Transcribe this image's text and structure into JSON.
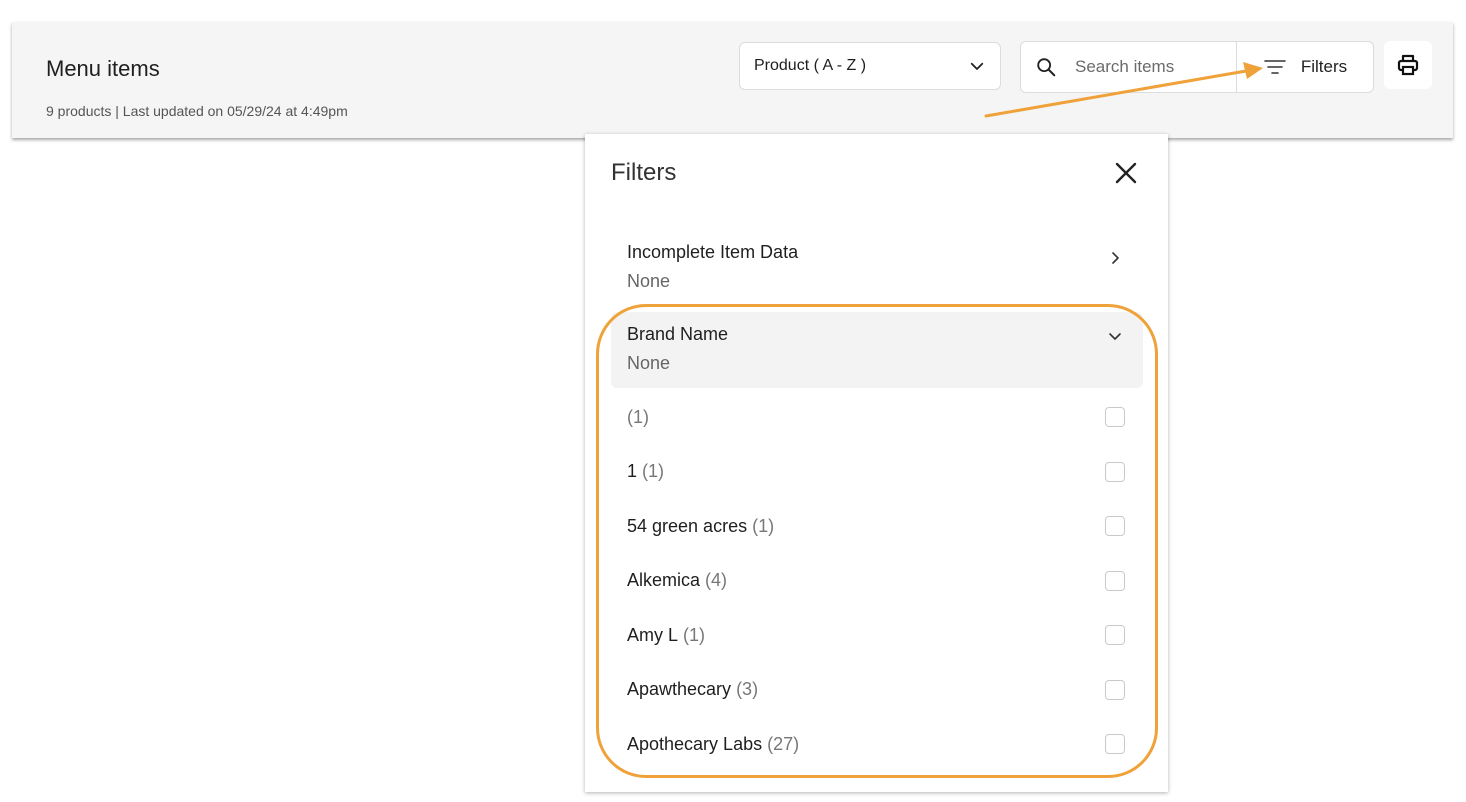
{
  "header": {
    "title": "Menu items",
    "subtitle": "9 products | Last updated on 05/29/24 at 4:49pm"
  },
  "sort": {
    "selected": "Product ( A - Z )"
  },
  "search": {
    "placeholder": "Search items",
    "value": ""
  },
  "filters_button": {
    "label": "Filters"
  },
  "filters_panel": {
    "title": "Filters",
    "sections": [
      {
        "name": "Incomplete Item Data",
        "value": "None",
        "state": "collapsed"
      },
      {
        "name": "Brand Name",
        "value": "None",
        "state": "expanded"
      }
    ],
    "brand_options": [
      {
        "label": "",
        "count": "(1)",
        "checked": false
      },
      {
        "label": "1",
        "count": "(1)",
        "checked": false
      },
      {
        "label": "54 green acres",
        "count": "(1)",
        "checked": false
      },
      {
        "label": "Alkemica",
        "count": "(4)",
        "checked": false
      },
      {
        "label": "Amy L",
        "count": "(1)",
        "checked": false
      },
      {
        "label": "Apawthecary",
        "count": "(3)",
        "checked": false
      },
      {
        "label": "Apothecary Labs",
        "count": "(27)",
        "checked": false
      }
    ]
  },
  "icons": {
    "sort": "chevron-down-icon",
    "search": "search-icon",
    "filters": "filter-lines-icon",
    "print": "printer-icon",
    "close": "close-icon",
    "incomplete_section": "chevron-right-icon",
    "brand_section": "chevron-down-icon"
  },
  "colors": {
    "annotation": "#f0a23a",
    "header_bg": "#f5f5f5",
    "expanded_section_bg": "#f3f3f3"
  }
}
